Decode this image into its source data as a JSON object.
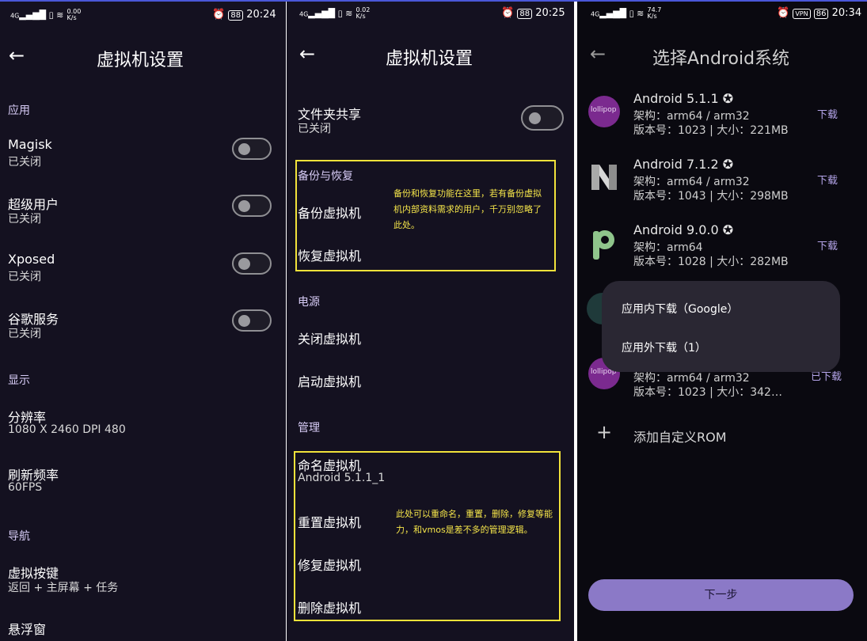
{
  "status_bars": [
    {
      "signal": "4G",
      "speed_value": "0.00",
      "speed_unit": "K/s",
      "battery": "88",
      "time": "20:24"
    },
    {
      "signal": "4G",
      "speed_value": "0.02",
      "speed_unit": "K/s",
      "battery": "88",
      "time": "20:25"
    },
    {
      "signal": "4G",
      "speed_value": "74.7",
      "speed_unit": "K/s",
      "battery": "86",
      "time": "20:34"
    }
  ],
  "panel1": {
    "title": "虚拟机设置",
    "sections": {
      "apps": "应用",
      "display": "显示",
      "navigation": "导航"
    },
    "toggles": [
      {
        "title": "Magisk",
        "sub": "已关闭",
        "on": false
      },
      {
        "title": "超级用户",
        "sub": "已关闭",
        "on": false
      },
      {
        "title": "Xposed",
        "sub": "已关闭",
        "on": false
      },
      {
        "title": "谷歌服务",
        "sub": "已关闭",
        "on": false
      }
    ],
    "resolution": {
      "title": "分辨率",
      "value": "1080 X 2460 DPI 480"
    },
    "refresh": {
      "title": "刷新频率",
      "value": "60FPS"
    },
    "virtual_keys": {
      "title": "虚拟按键",
      "value": "返回 + 主屏幕 + 任务"
    },
    "cut_item": "悬浮窗"
  },
  "panel2": {
    "title": "虚拟机设置",
    "folder_share": {
      "title": "文件夹共享",
      "sub": "已关闭",
      "on": false
    },
    "backup_section": "备份与恢复",
    "backup": "备份虚拟机",
    "restore": "恢复虚拟机",
    "backup_note": "备份和恢复功能在这里，若有备份虚拟机内部资料需求的用户，千万别忽略了此处。",
    "power_section": "电源",
    "shutdown": "关闭虚拟机",
    "start": "启动虚拟机",
    "manage_section": "管理",
    "rename": {
      "title": "命名虚拟机",
      "value": "Android 5.1.1_1"
    },
    "reset": "重置虚拟机",
    "repair": "修复虚拟机",
    "delete": "删除虚拟机",
    "manage_note": "此处可以重命名，重置，删除，修复等能力，和vmos是差不多的管理逻辑。"
  },
  "panel3": {
    "title": "选择Android系统",
    "roms": [
      {
        "name": "Android 5.1.1",
        "arch": "架构：arm64 / arm32",
        "version": "版本号：1023 | 大小：221MB",
        "action": "下载",
        "logo": "lollipop"
      },
      {
        "name": "Android 7.1.2",
        "arch": "架构：arm64 / arm32",
        "version": "版本号：1043 | 大小：298MB",
        "action": "下载",
        "logo": "N"
      },
      {
        "name": "Android 9.0.0",
        "arch": "架构：arm64",
        "version": "版本号：1028 | 大小：282MB",
        "action": "下载",
        "logo": "P"
      },
      {
        "name": "",
        "arch": "架构：arm64 / arm32",
        "version": "版本号：1023 | 大小：342…",
        "action": "已下载",
        "logo": "lollipop"
      }
    ],
    "menu": {
      "inside": "应用内下载（Google）",
      "outside": "应用外下载（1）"
    },
    "add_rom": "添加自定义ROM",
    "next": "下一步",
    "verified_color": "#cfcfcf",
    "accent": "#8b79c7"
  }
}
